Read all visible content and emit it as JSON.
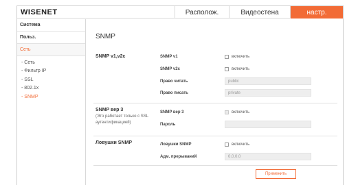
{
  "app": {
    "logo": "WISENET"
  },
  "tabs": [
    {
      "label": "Располож."
    },
    {
      "label": "Видеостена"
    },
    {
      "label": "настр."
    }
  ],
  "sidebar": {
    "items": [
      {
        "label": "Система"
      },
      {
        "label": "Польз."
      },
      {
        "label": "Сеть"
      }
    ],
    "subitems": [
      {
        "label": "- Сеть"
      },
      {
        "label": "- Фильтр IP"
      },
      {
        "label": "- SSL"
      },
      {
        "label": "- 802.1x"
      },
      {
        "label": "- SNMP"
      }
    ]
  },
  "page": {
    "title": "SNMP"
  },
  "snmp_v12": {
    "title": "SNMP v1,v2c",
    "v1_label": "SNMP v1",
    "v1_checkbox": "включить",
    "v2c_label": "SNMP v2c",
    "v2c_checkbox": "включить",
    "read_label": "Право читать",
    "read_value": "public",
    "write_label": "Право писать",
    "write_value": "private"
  },
  "snmp_v3": {
    "title": "SNMP вер 3",
    "note": "(Это работает только с SSL аутентификацией)",
    "v3_label": "SNMP вер 3",
    "v3_checkbox": "включить",
    "password_label": "Пароль",
    "password_value": ""
  },
  "traps": {
    "title": "Ловушки SNMP",
    "traps_label": "Ловушки SNMP",
    "traps_checkbox": "включить",
    "addr_label": "Адм. прерываний",
    "addr_value": "0.0.0.0"
  },
  "actions": {
    "apply_label": "Применить"
  },
  "colors": {
    "accent": "#f26b36",
    "field_bg": "#eeeeee"
  }
}
